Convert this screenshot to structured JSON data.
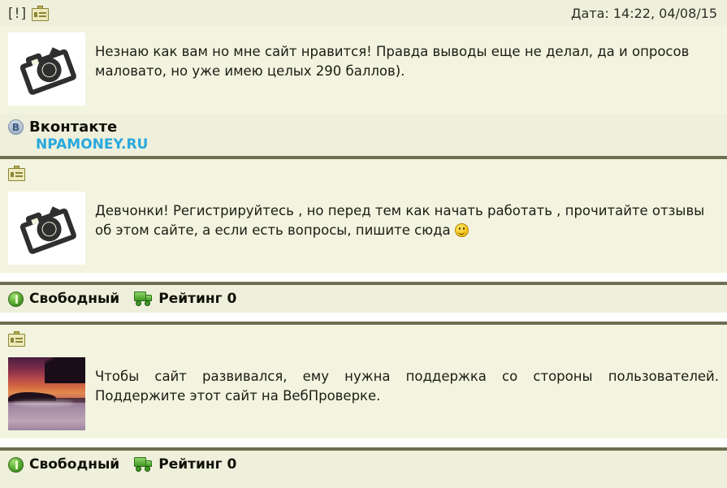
{
  "header": {
    "alert_marker": "[!]",
    "card_icon": "id-card-icon",
    "date_text": "Дата: 14:22, 04/08/15"
  },
  "messages": [
    {
      "card_icon": "id-card-icon",
      "thumbnail_type": "broken-image-camera-placeholder",
      "text": "Незнаю как вам но мне сайт нравится! Правда выводы еще не делал, да и опросов маловато, но уже имею целых 290 баллов)."
    },
    {
      "card_icon": "id-card-icon",
      "thumbnail_type": "broken-image-camera-placeholder",
      "text_before_emoji": "Девчонки! Регистрируйтесь , но перед тем как начать работать , прочитайте отзывы об этом сайте, а если есть вопросы, пишите сюда ",
      "emoji": "smiling-face-emoji"
    },
    {
      "card_icon": "id-card-icon",
      "thumbnail_type": "sunset-lake-photo",
      "text": "Чтобы сайт развивался, ему нужна поддержка со стороны пользователей. Поддержите этот сайт на ВебПроверке."
    }
  ],
  "social": {
    "icon": "vk-icon",
    "icon_letter": "В",
    "network_name": "Вконтакте",
    "site_link": "NPAMONEY.RU",
    "link_color": "#29a8dd"
  },
  "status_rows": [
    {
      "availability_icon": "green-status-circle-icon",
      "availability_label": "Свободный",
      "rating_icon": "green-truck-icon",
      "rating_label": "Рейтинг 0"
    },
    {
      "availability_icon": "green-status-circle-icon",
      "availability_label": "Свободный",
      "rating_icon": "green-truck-icon",
      "rating_label": "Рейтинг 0"
    }
  ],
  "colors": {
    "page_background": "#eef0dc",
    "message_background": "#f2f4df",
    "separator": "#6e6f52",
    "text": "#1c1c14"
  }
}
